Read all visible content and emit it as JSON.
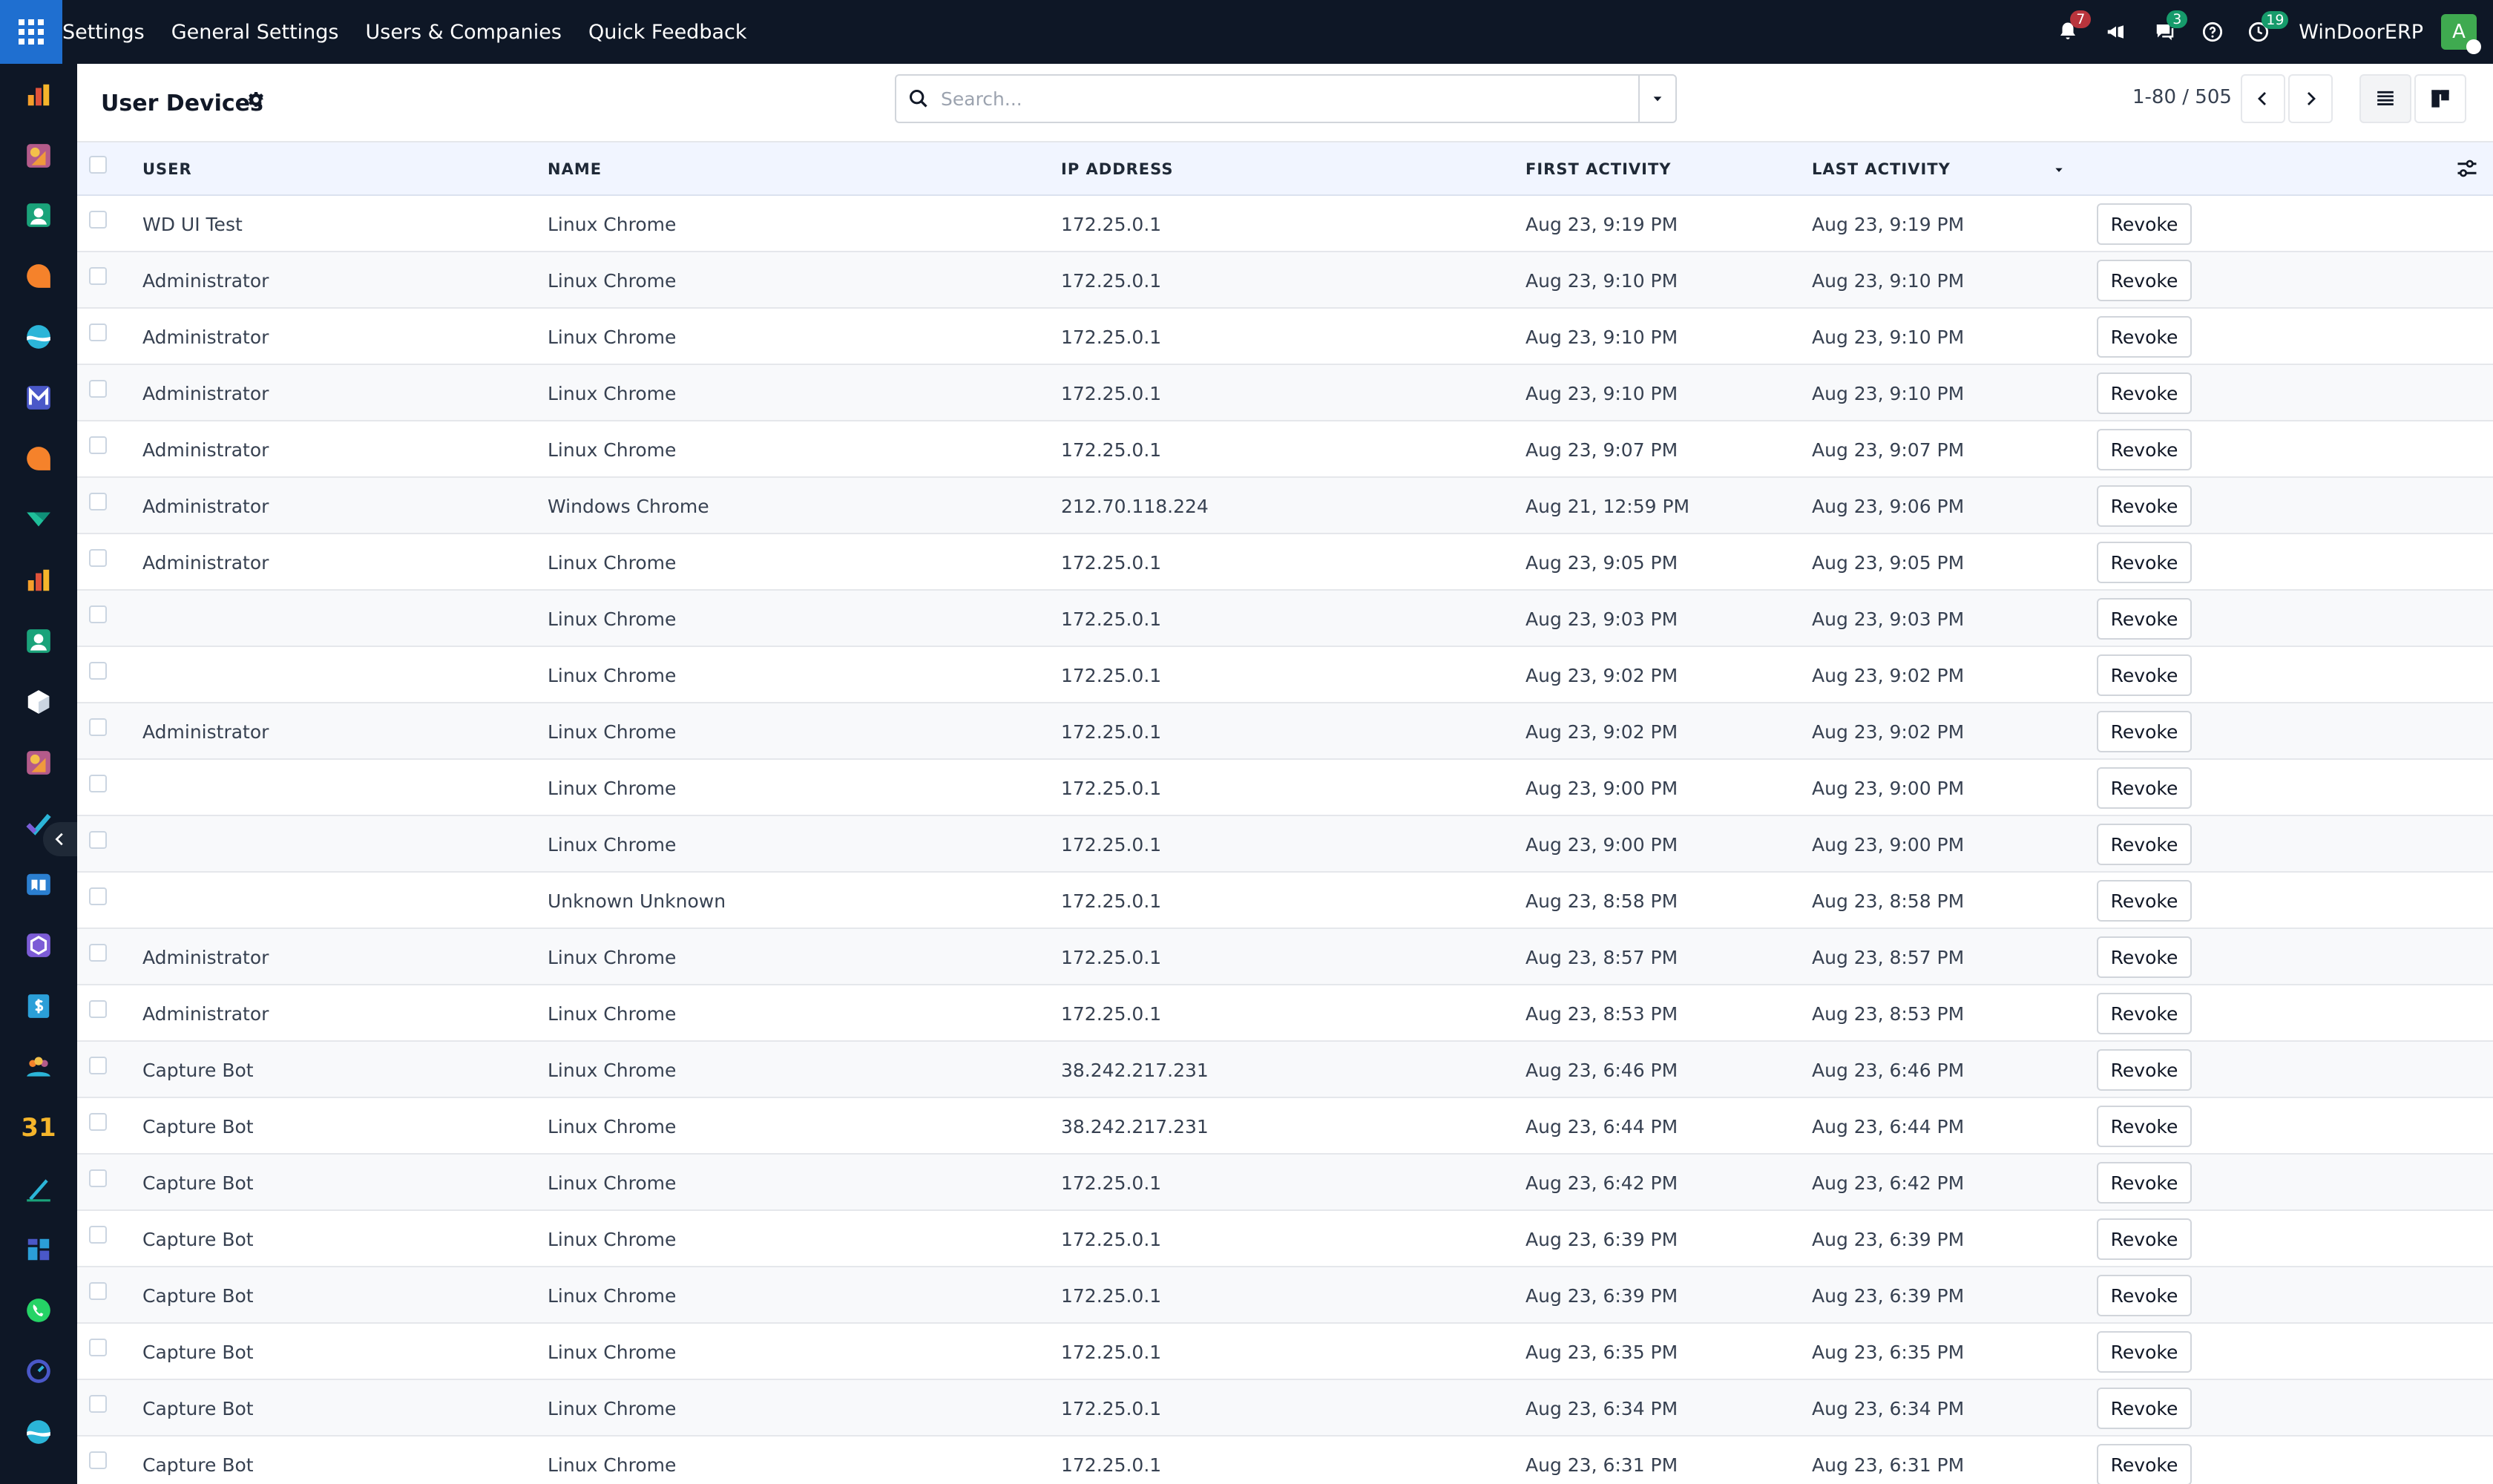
{
  "topbar": {
    "menu": [
      "Settings",
      "General Settings",
      "Users & Companies",
      "Quick Feedback"
    ],
    "activity_count": "7",
    "messages_count": "3",
    "timer_count": "19",
    "company": "WinDoorERP",
    "avatar_initial": "A",
    "colors": {
      "bar": "#0e1726",
      "apps": "#1f6fd0",
      "badge_red": "#b8343c",
      "badge_green": "#169b6b",
      "avatar": "#3faa50"
    }
  },
  "sidebar": {
    "apps": [
      "sales-app-icon",
      "crm-app-icon",
      "contacts-app-icon",
      "discuss-app-icon",
      "website-app-icon",
      "email-marketing-app-icon",
      "livechat-app-icon",
      "documents-app-icon",
      "reporting-app-icon",
      "employees-app-icon",
      "inventory-app-icon",
      "field-service-app-icon",
      "project-app-icon",
      "knowledge-app-icon",
      "studio-app-icon",
      "invoicing-app-icon",
      "team-app-icon",
      "calendar-app-icon",
      "sign-app-icon",
      "dashboards-app-icon",
      "whatsapp-app-icon",
      "planning-app-icon",
      "marketing-app-icon"
    ],
    "calendar_label": "31"
  },
  "control": {
    "title": "User Devices",
    "search_placeholder": "Search...",
    "pager": "1-80 / 505"
  },
  "table": {
    "headers": {
      "user": "USER",
      "name": "NAME",
      "ip": "IP ADDRESS",
      "first": "FIRST ACTIVITY",
      "last": "LAST ACTIVITY"
    },
    "action_label": "Revoke",
    "rows": [
      {
        "user": "WD UI Test",
        "name": "Linux Chrome",
        "ip": "172.25.0.1",
        "first": "Aug 23, 9:19 PM",
        "last": "Aug 23, 9:19 PM"
      },
      {
        "user": "Administrator",
        "name": "Linux Chrome",
        "ip": "172.25.0.1",
        "first": "Aug 23, 9:10 PM",
        "last": "Aug 23, 9:10 PM"
      },
      {
        "user": "Administrator",
        "name": "Linux Chrome",
        "ip": "172.25.0.1",
        "first": "Aug 23, 9:10 PM",
        "last": "Aug 23, 9:10 PM"
      },
      {
        "user": "Administrator",
        "name": "Linux Chrome",
        "ip": "172.25.0.1",
        "first": "Aug 23, 9:10 PM",
        "last": "Aug 23, 9:10 PM"
      },
      {
        "user": "Administrator",
        "name": "Linux Chrome",
        "ip": "172.25.0.1",
        "first": "Aug 23, 9:07 PM",
        "last": "Aug 23, 9:07 PM"
      },
      {
        "user": "Administrator",
        "name": "Windows Chrome",
        "ip": "212.70.118.224",
        "first": "Aug 21, 12:59 PM",
        "last": "Aug 23, 9:06 PM"
      },
      {
        "user": "Administrator",
        "name": "Linux Chrome",
        "ip": "172.25.0.1",
        "first": "Aug 23, 9:05 PM",
        "last": "Aug 23, 9:05 PM"
      },
      {
        "user": "",
        "name": "Linux Chrome",
        "ip": "172.25.0.1",
        "first": "Aug 23, 9:03 PM",
        "last": "Aug 23, 9:03 PM"
      },
      {
        "user": "",
        "name": "Linux Chrome",
        "ip": "172.25.0.1",
        "first": "Aug 23, 9:02 PM",
        "last": "Aug 23, 9:02 PM"
      },
      {
        "user": "Administrator",
        "name": "Linux Chrome",
        "ip": "172.25.0.1",
        "first": "Aug 23, 9:02 PM",
        "last": "Aug 23, 9:02 PM"
      },
      {
        "user": "",
        "name": "Linux Chrome",
        "ip": "172.25.0.1",
        "first": "Aug 23, 9:00 PM",
        "last": "Aug 23, 9:00 PM"
      },
      {
        "user": "",
        "name": "Linux Chrome",
        "ip": "172.25.0.1",
        "first": "Aug 23, 9:00 PM",
        "last": "Aug 23, 9:00 PM"
      },
      {
        "user": "",
        "name": "Unknown Unknown",
        "ip": "172.25.0.1",
        "first": "Aug 23, 8:58 PM",
        "last": "Aug 23, 8:58 PM"
      },
      {
        "user": "Administrator",
        "name": "Linux Chrome",
        "ip": "172.25.0.1",
        "first": "Aug 23, 8:57 PM",
        "last": "Aug 23, 8:57 PM"
      },
      {
        "user": "Administrator",
        "name": "Linux Chrome",
        "ip": "172.25.0.1",
        "first": "Aug 23, 8:53 PM",
        "last": "Aug 23, 8:53 PM"
      },
      {
        "user": "Capture Bot",
        "name": "Linux Chrome",
        "ip": "38.242.217.231",
        "first": "Aug 23, 6:46 PM",
        "last": "Aug 23, 6:46 PM"
      },
      {
        "user": "Capture Bot",
        "name": "Linux Chrome",
        "ip": "38.242.217.231",
        "first": "Aug 23, 6:44 PM",
        "last": "Aug 23, 6:44 PM"
      },
      {
        "user": "Capture Bot",
        "name": "Linux Chrome",
        "ip": "172.25.0.1",
        "first": "Aug 23, 6:42 PM",
        "last": "Aug 23, 6:42 PM"
      },
      {
        "user": "Capture Bot",
        "name": "Linux Chrome",
        "ip": "172.25.0.1",
        "first": "Aug 23, 6:39 PM",
        "last": "Aug 23, 6:39 PM"
      },
      {
        "user": "Capture Bot",
        "name": "Linux Chrome",
        "ip": "172.25.0.1",
        "first": "Aug 23, 6:39 PM",
        "last": "Aug 23, 6:39 PM"
      },
      {
        "user": "Capture Bot",
        "name": "Linux Chrome",
        "ip": "172.25.0.1",
        "first": "Aug 23, 6:35 PM",
        "last": "Aug 23, 6:35 PM"
      },
      {
        "user": "Capture Bot",
        "name": "Linux Chrome",
        "ip": "172.25.0.1",
        "first": "Aug 23, 6:34 PM",
        "last": "Aug 23, 6:34 PM"
      },
      {
        "user": "Capture Bot",
        "name": "Linux Chrome",
        "ip": "172.25.0.1",
        "first": "Aug 23, 6:31 PM",
        "last": "Aug 23, 6:31 PM"
      }
    ]
  }
}
